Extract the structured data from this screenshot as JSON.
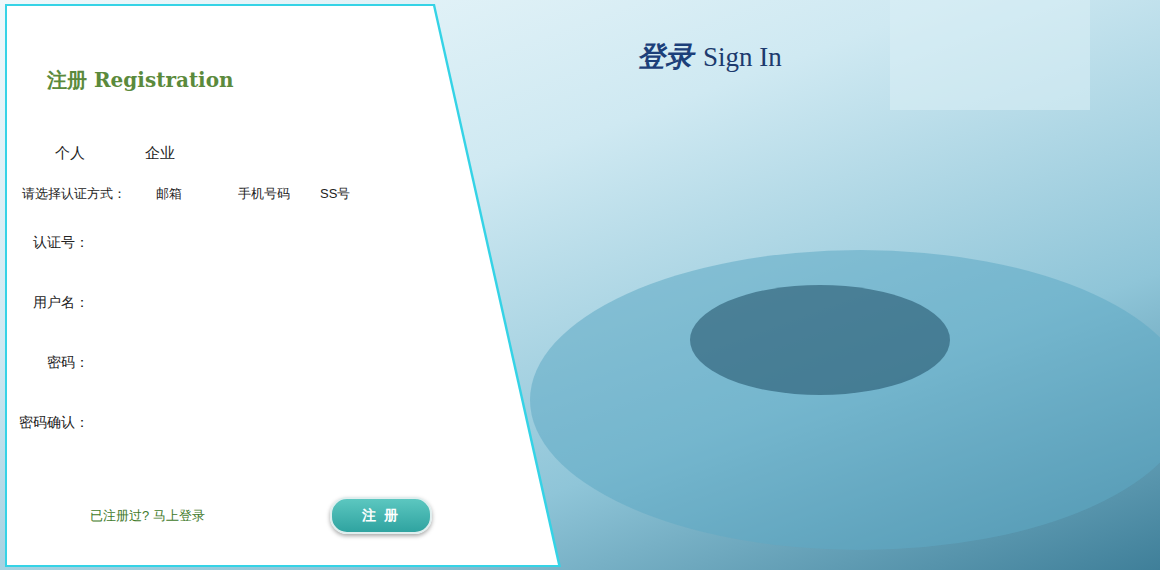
{
  "registration": {
    "title": "注册 Registration",
    "account_types": [
      {
        "label": "个人"
      },
      {
        "label": "企业"
      }
    ],
    "method_prompt": "请选择认证方式：",
    "methods": [
      {
        "label": "邮箱"
      },
      {
        "label": "手机号码"
      },
      {
        "label": "SS号"
      }
    ],
    "fields": [
      {
        "label": "认证号："
      },
      {
        "label": "用户名："
      },
      {
        "label": "密码："
      },
      {
        "label": "密码确认："
      }
    ],
    "login_prompt": "已注册过? 马上登录",
    "submit": "注 册"
  },
  "sign_in": {
    "title_cn": "登录",
    "title_en": "Sign In"
  }
}
